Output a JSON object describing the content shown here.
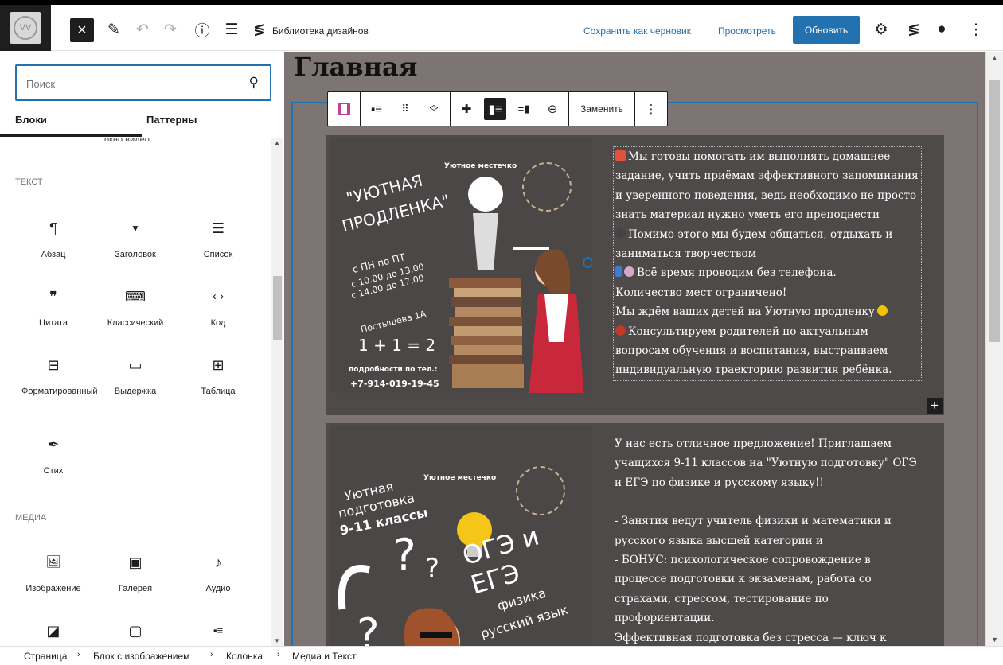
{
  "header": {
    "logo_text": "VV",
    "close_icon": "×",
    "pencil_icon": "✎",
    "undo_icon": "↶",
    "redo_icon": "↷",
    "info_icon": "ⓘ",
    "list_view_icon": "☰",
    "library_icon": "≶",
    "library_label": "Библиотека дизайнов",
    "save_draft": "Сохранить как черновик",
    "preview": "Просмотреть",
    "update": "Обновить",
    "settings_icon": "⚙",
    "plugin_icon": "≶",
    "extra_icon": "●",
    "more_icon": "⋮"
  },
  "sidebar": {
    "search_placeholder": "Поиск",
    "search_icon": "⚲",
    "tabs": [
      "Блоки",
      "Паттерны"
    ],
    "cutoff_label": "окно видео",
    "sections": [
      {
        "title": "ТЕКСТ",
        "items": [
          {
            "icon": "¶",
            "label": "Абзац"
          },
          {
            "icon": "▼",
            "label": "Заголовок"
          },
          {
            "icon": "☰",
            "label": "Список"
          },
          {
            "icon": "❞",
            "label": "Цитата"
          },
          {
            "icon": "⌨",
            "label": "Классический"
          },
          {
            "icon": "‹ ›",
            "label": "Код"
          },
          {
            "icon": "⊟",
            "label": "Форматированный"
          },
          {
            "icon": "▭",
            "label": "Выдержка"
          },
          {
            "icon": "⊞",
            "label": "Таблица"
          },
          {
            "icon": "✒",
            "label": "Стих"
          }
        ]
      },
      {
        "title": "МЕДИА",
        "items": [
          {
            "icon": "🖼",
            "label": "Изображение"
          },
          {
            "icon": "▣",
            "label": "Галерея"
          },
          {
            "icon": "♪",
            "label": "Аудио"
          },
          {
            "icon": "◪",
            "label": ""
          },
          {
            "icon": "▢",
            "label": ""
          },
          {
            "icon": "▪≡",
            "label": ""
          }
        ]
      }
    ]
  },
  "canvas": {
    "page_title": "Главная",
    "toolbar": {
      "replace_label": "Заменить",
      "more_icon": "⋮"
    },
    "block1": {
      "image": {
        "brand": "Уютное местечко",
        "title_line1": "\"УЮТНАЯ",
        "title_line2": "ПРОДЛЕНКА\"",
        "schedule1": "с ПН по ПТ",
        "schedule2": "с 10.00 до 13.00",
        "schedule3": "с 14.00 до 17.00",
        "address": "Постышева 1А",
        "equation": "1 + 1 = 2",
        "contacts_label": "подробности по тел.:",
        "phone": "+7-914-019-19-45"
      },
      "paragraphs": [
        "Мы готовы помогать им выполнять домашнее задание, учить приёмам эффективного запоминания и уверенного поведения, ведь необходимо не просто знать материал нужно уметь его преподнести",
        "Помимо этого мы будем общаться, отдыхать и заниматься творчеством",
        "Всё время проводим без телефона.",
        "Количество мест ограничено!",
        "Мы ждём ваших детей на Уютную продленку",
        "Консультируем родителей по актуальным вопросам обучения и воспитания, выстраиваем индивидуальную траекторию развития ребёнка."
      ],
      "add_icon": "+"
    },
    "block2": {
      "image": {
        "brand": "Уютное местечко",
        "title_line1": "Уютная",
        "title_line2": "подготовка",
        "title_line3": "9-11 классы",
        "exam": "ОГЭ и ЕГЭ",
        "subjects1": "физика",
        "subjects2": "русский язык"
      },
      "paragraphs": [
        "У нас есть отличное предложение! Приглашаем учащихся 9-11 классов на \"Уютную подготовку\" ОГЭ и ЕГЭ по физике и русскому языку!!",
        "",
        "- Занятия ведут учитель физики и математики и русского языка высшей категории и",
        "- БОНУС: психологическое сопровождение в процессе подготовки к экзаменам, работа со страхами, стрессом, тестирование по профориентации.",
        "Эффективная подготовка без стресса — ключ к"
      ]
    }
  },
  "breadcrumb": [
    "Страница",
    "Блок с изображением",
    "Колонка",
    "Медиа и Текст"
  ],
  "breadcrumb_separator": "›",
  "colors": {
    "accent": "#2271b1",
    "canvas_bg": "#7d7574",
    "block_bg": "#4d4a49"
  }
}
